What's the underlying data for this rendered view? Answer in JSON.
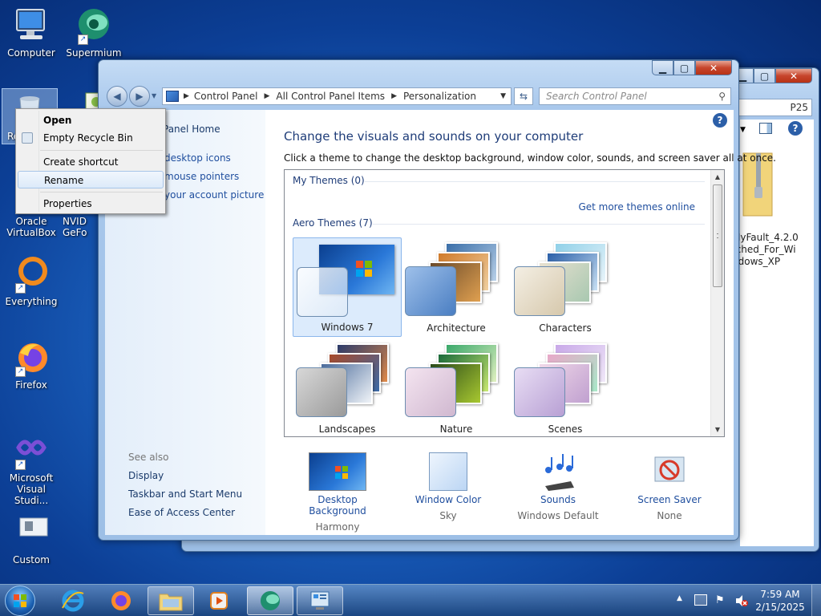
{
  "desktop": {
    "icons": [
      {
        "label": "Computer"
      },
      {
        "label": "Supermium"
      },
      {
        "label": "Re"
      },
      {
        "label": "Oracle VirtualBox"
      },
      {
        "label": "NVID GeFo"
      },
      {
        "label": "Everything"
      },
      {
        "label": "Firefox"
      },
      {
        "label": "Microsoft Visual Studi..."
      },
      {
        "label": "Custom"
      }
    ]
  },
  "context_menu": {
    "items": [
      "Open",
      "Empty Recycle Bin",
      "Create shortcut",
      "Rename",
      "Properties"
    ],
    "highlighted": "Rename"
  },
  "back_window": {
    "search_value": "P25",
    "file_label": "MyFault_4.2.0 tched_For_Wi ndows_XP"
  },
  "personalization": {
    "breadcrumb": [
      "Control Panel",
      "All Control Panel Items",
      "Personalization"
    ],
    "search_placeholder": "Search Control Panel",
    "left_links": [
      "Panel Home",
      "desktop icons",
      "mouse pointers",
      "your account picture"
    ],
    "see_also_label": "See also",
    "see_also": [
      "Display",
      "Taskbar and Start Menu",
      "Ease of Access Center"
    ],
    "heading": "Change the visuals and sounds on your computer",
    "subheading": "Click a theme to change the desktop background, window color, sounds, and screen saver all at once.",
    "my_themes_label": "My Themes (0)",
    "get_more_link": "Get more themes online",
    "aero_themes_label": "Aero Themes (7)",
    "themes": [
      {
        "name": "Windows 7",
        "selected": true
      },
      {
        "name": "Architecture"
      },
      {
        "name": "Characters"
      },
      {
        "name": "Landscapes"
      },
      {
        "name": "Nature"
      },
      {
        "name": "Scenes"
      }
    ],
    "bottom": [
      {
        "title": "Desktop Background",
        "sub": "Harmony"
      },
      {
        "title": "Window Color",
        "sub": "Sky"
      },
      {
        "title": "Sounds",
        "sub": "Windows Default"
      },
      {
        "title": "Screen Saver",
        "sub": "None"
      }
    ]
  },
  "taskbar": {
    "time": "7:59 AM",
    "date": "2/15/2025"
  },
  "colors": {
    "link": "#1f4e9e",
    "selection": "#dcebfc",
    "close_button": "#c7452c"
  }
}
